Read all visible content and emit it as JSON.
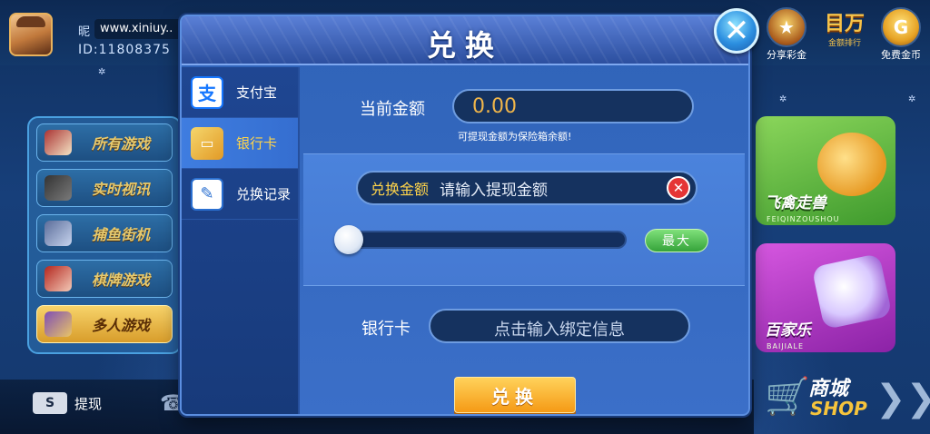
{
  "user": {
    "nickname_label": "昵",
    "nickname": "www.xiniuy..",
    "id_text": "ID:11808375"
  },
  "top_right": {
    "share_label": "分享彩金",
    "ranking_text": "目万",
    "ranking_sub": "金额排行",
    "free_gold_label": "免费金币",
    "gold_icon_text": "G"
  },
  "left_menu": [
    {
      "label": "所有游戏",
      "icon": "cards-icon"
    },
    {
      "label": "实时视讯",
      "icon": "tv-icon"
    },
    {
      "label": "捕鱼街机",
      "icon": "fish-icon"
    },
    {
      "label": "棋牌游戏",
      "icon": "chess-icon"
    },
    {
      "label": "多人游戏",
      "icon": "multiplayer-icon"
    }
  ],
  "game_tiles": [
    {
      "name": "飞禽走兽",
      "sub": "FEIQINZOUSHOU"
    },
    {
      "name": "百家乐",
      "sub": "BAIJIALE"
    }
  ],
  "shop": {
    "cn": "商城",
    "en": "SHOP",
    "arrows": "❯❯"
  },
  "bottom_bar": {
    "withdraw_label": "提现",
    "withdraw_icon_text": "S"
  },
  "modal": {
    "title": "兑换",
    "close_icon": "✕",
    "tabs": [
      {
        "label": "支付宝",
        "icon_text": "支",
        "active": false
      },
      {
        "label": "银行卡",
        "icon_text": "▭",
        "active": true
      },
      {
        "label": "兑换记录",
        "icon_text": "✎",
        "active": false
      }
    ],
    "balance_label": "当前金额",
    "balance_value": "0.00",
    "balance_note": "可提现金额为保险箱余额!",
    "amount_label": "兑换金额",
    "amount_placeholder": "请输入提现金额",
    "clear_icon": "✕",
    "slider_level": 0,
    "max_label": "最大",
    "bank_label": "银行卡",
    "bank_placeholder": "点击输入绑定信息",
    "submit_label": "兑换"
  },
  "colors": {
    "accent_gold": "#ffd44a",
    "balance_orange": "#f0b64a",
    "clear_red": "#e53535",
    "max_green": "#35a33a",
    "submit_orange": "#f59a15"
  }
}
